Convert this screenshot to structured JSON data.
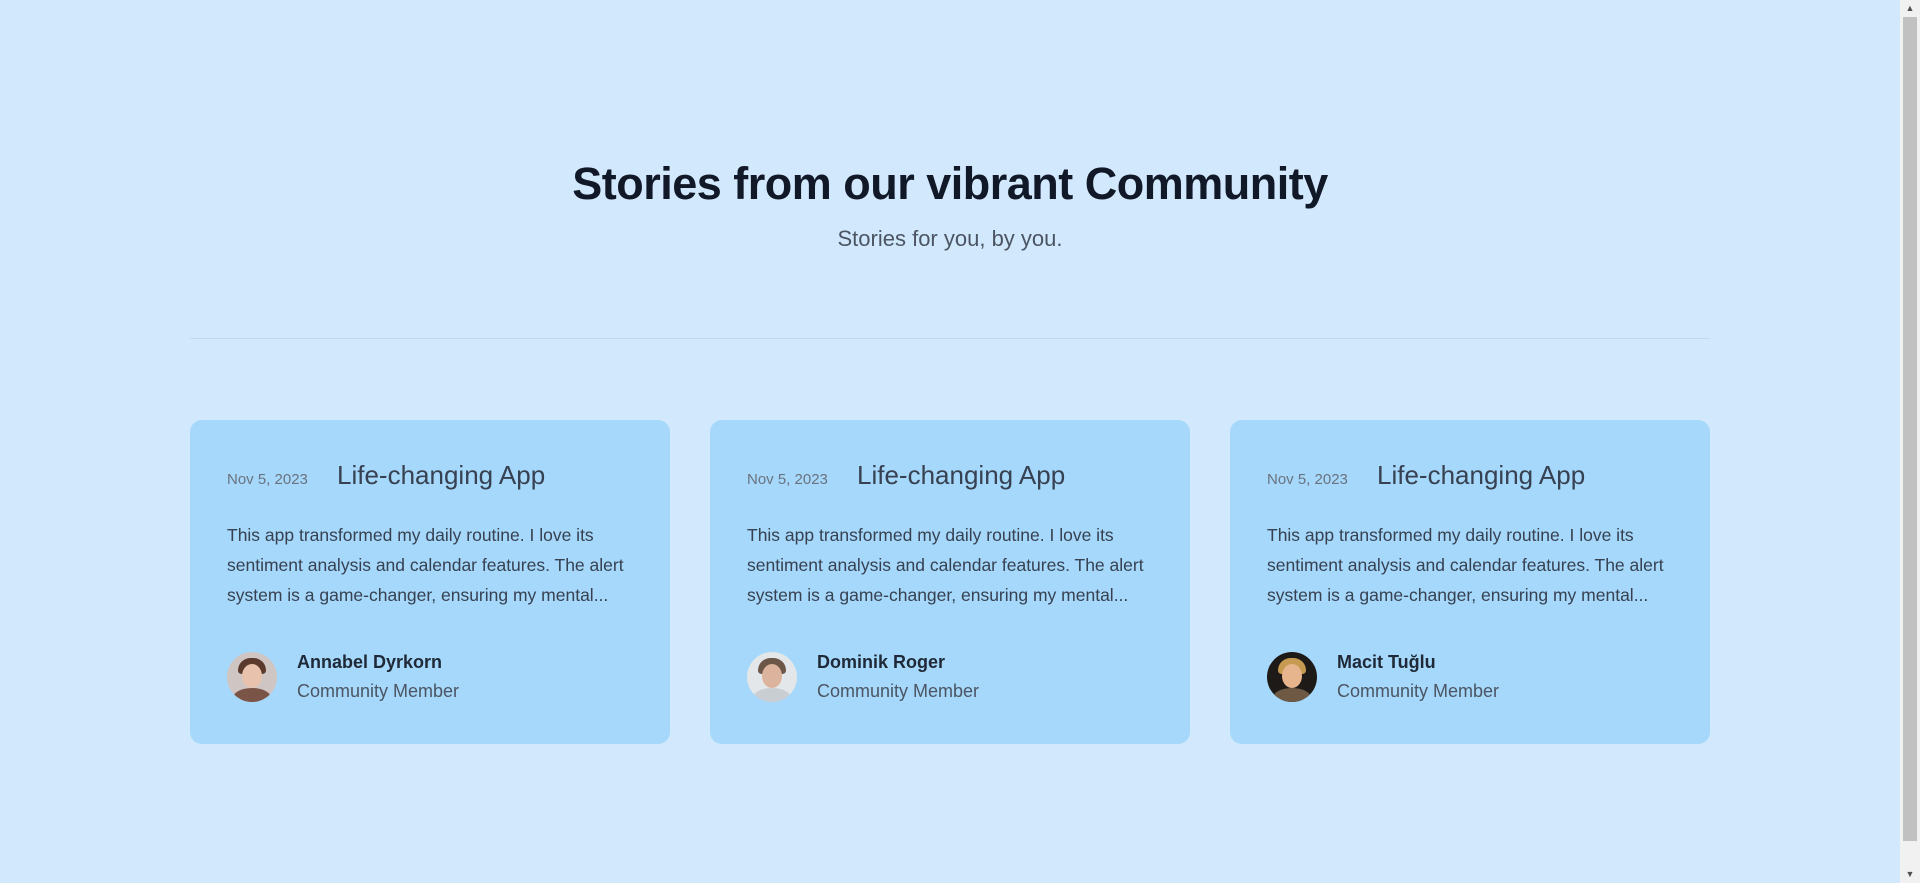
{
  "header": {
    "title": "Stories from our vibrant Community",
    "subtitle": "Stories for you, by you."
  },
  "posts": [
    {
      "date": "Nov 5, 2023",
      "title": "Life-changing App",
      "excerpt": "This app transformed my daily routine. I love its sentiment analysis and calendar features. The alert system is a game-changer, ensuring my mental...",
      "author": {
        "name": "Annabel Dyrkorn",
        "role": "Community Member"
      }
    },
    {
      "date": "Nov 5, 2023",
      "title": "Life-changing App",
      "excerpt": "This app transformed my daily routine. I love its sentiment analysis and calendar features. The alert system is a game-changer, ensuring my mental...",
      "author": {
        "name": "Dominik Roger",
        "role": "Community Member"
      }
    },
    {
      "date": "Nov 5, 2023",
      "title": "Life-changing App",
      "excerpt": "This app transformed my daily routine. I love its sentiment analysis and calendar features. The alert system is a game-changer, ensuring my mental...",
      "author": {
        "name": "Macit Tuğlu",
        "role": "Community Member"
      }
    }
  ],
  "colors": {
    "background": "#d2e8fc",
    "card": "#a5d8fa",
    "heading": "#111827",
    "muted": "#4b5563"
  },
  "icons": {
    "scroll_up": "scroll-up-arrow-icon",
    "scroll_down": "scroll-down-arrow-icon"
  }
}
